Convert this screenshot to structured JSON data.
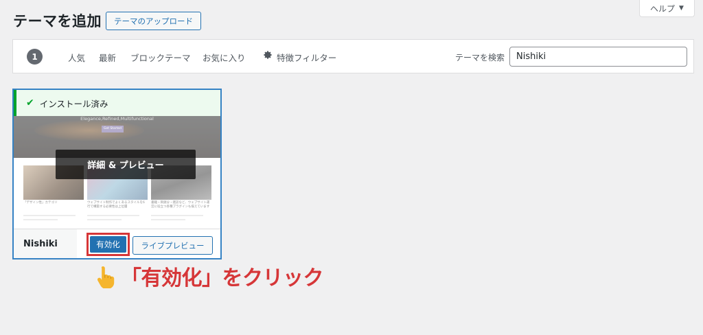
{
  "help": {
    "label": "ヘルプ",
    "caret": "▼"
  },
  "header": {
    "title": "テーマを追加",
    "upload_label": "テーマのアップロード"
  },
  "filters": {
    "count": "1",
    "items": [
      "人気",
      "最新",
      "ブロックテーマ",
      "お気に入り"
    ],
    "feature_filter_label": "特徴フィルター",
    "search_label": "テーマを検索",
    "search_value": "Nishiki"
  },
  "theme": {
    "installed_label": "インストール済み",
    "details_label": "詳細 & プレビュー",
    "name": "Nishiki",
    "activate_label": "有効化",
    "live_preview_label": "ライブプレビュー",
    "screenshot": {
      "hero_text": "Elegance,Refined,Multifunctional",
      "hero_button": "Get Started",
      "captions": [
        "「デザイン性」カテゴリ",
        "ウェブサイト制作でよくあるスタイルを6行で構築する必要性は上位層",
        "書籍・目録分・雑誌など、ウェブサイト運営に役立つ各種プラグインも揃えています"
      ]
    }
  },
  "annotation": {
    "text": "「有効化」をクリック",
    "icon": "pointing-hand-icon"
  },
  "colors": {
    "accent": "#2271b1",
    "highlight": "#d63638",
    "installed": "#00a32a"
  }
}
